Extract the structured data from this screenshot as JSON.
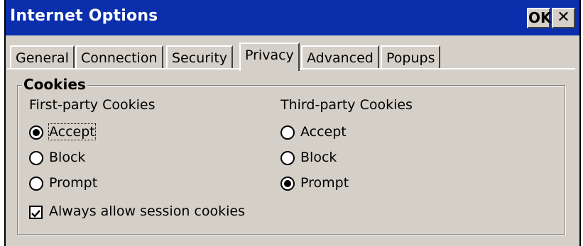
{
  "window": {
    "title": "Internet Options",
    "ok_label": "OK",
    "close_label": "✕"
  },
  "tabs": [
    {
      "label": "General"
    },
    {
      "label": "Connection"
    },
    {
      "label": "Security"
    },
    {
      "label": "Privacy",
      "selected": true
    },
    {
      "label": "Advanced"
    },
    {
      "label": "Popups"
    }
  ],
  "cookies": {
    "group_title": "Cookies",
    "first_party": {
      "heading": "First-party Cookies",
      "options": [
        "Accept",
        "Block",
        "Prompt"
      ],
      "selected": "Accept"
    },
    "third_party": {
      "heading": "Third-party Cookies",
      "options": [
        "Accept",
        "Block",
        "Prompt"
      ],
      "selected": "Prompt"
    },
    "session": {
      "label": "Always allow session cookies",
      "checked": true
    }
  }
}
